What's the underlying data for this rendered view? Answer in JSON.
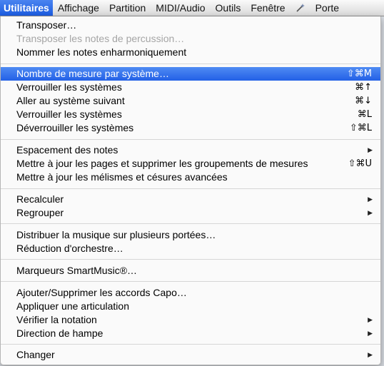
{
  "menubar": {
    "items": [
      "Utilitaires",
      "Affichage",
      "Partition",
      "MIDI/Audio",
      "Outils",
      "Fenêtre"
    ],
    "icon": "magic-wand-icon",
    "trailing": "Porte"
  },
  "menu": {
    "transpose": "Transposer…",
    "transpose_perc": "Transposer les notes de percussion…",
    "enharmonic": "Nommer les notes enharmoniquement",
    "measures_per_system": {
      "label": "Nombre de mesure par système…",
      "shortcut": "⇧⌘M"
    },
    "lock_systems_1": {
      "label": "Verrouiller les systèmes",
      "shortcut": "⌘↑"
    },
    "next_system": {
      "label": "Aller au système suivant",
      "shortcut": "⌘↓"
    },
    "lock_systems_2": {
      "label": "Verrouiller les systèmes",
      "shortcut": "⌘L"
    },
    "unlock_systems": {
      "label": "Déverrouiller les systèmes",
      "shortcut": "⇧⌘L"
    },
    "note_spacing": "Espacement des notes",
    "update_pages": {
      "label": "Mettre à jour les pages et supprimer les groupements de mesures",
      "shortcut": "⇧⌘U"
    },
    "update_melisma": "Mettre à jour les mélismes et césures avancées",
    "recalc": "Recalculer",
    "regroup": "Regrouper",
    "distribute": "Distribuer la musique sur plusieurs portées…",
    "reduction": "Réduction d'orchestre…",
    "smartmusic": "Marqueurs SmartMusic®…",
    "capo": "Ajouter/Supprimer les accords Capo…",
    "articulation": "Appliquer une articulation",
    "check_notation": "Vérifier la notation",
    "stem_direction": "Direction de hampe",
    "change": "Changer"
  },
  "colors": {
    "highlight": "#2a66e8"
  }
}
